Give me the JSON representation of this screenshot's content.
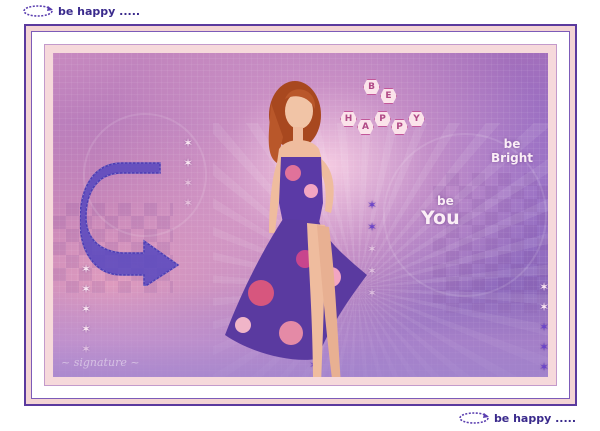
{
  "header_caption": {
    "text": "be happy .....",
    "icon": "circular-arrow-icon"
  },
  "footer_caption": {
    "text": "be happy .....",
    "icon": "circular-arrow-icon"
  },
  "artwork": {
    "hex_words": {
      "be": [
        "B",
        "E"
      ],
      "happy": [
        "H",
        "A",
        "P",
        "P",
        "Y"
      ]
    },
    "bright_line1": "be",
    "bright_line2": "Bright",
    "you_line1": "be",
    "you_line2": "You",
    "arrow_icon": "curved-dotted-arrow-icon",
    "star_icon": "star-icon",
    "colors": {
      "frame_border": "#5b3a9e",
      "frame_fill": "#f3d4d4",
      "caption": "#3a2a8c",
      "star_light": "#fbe7f2",
      "star_violet": "#6b45c9",
      "hex_letter": "#b14a86"
    }
  }
}
